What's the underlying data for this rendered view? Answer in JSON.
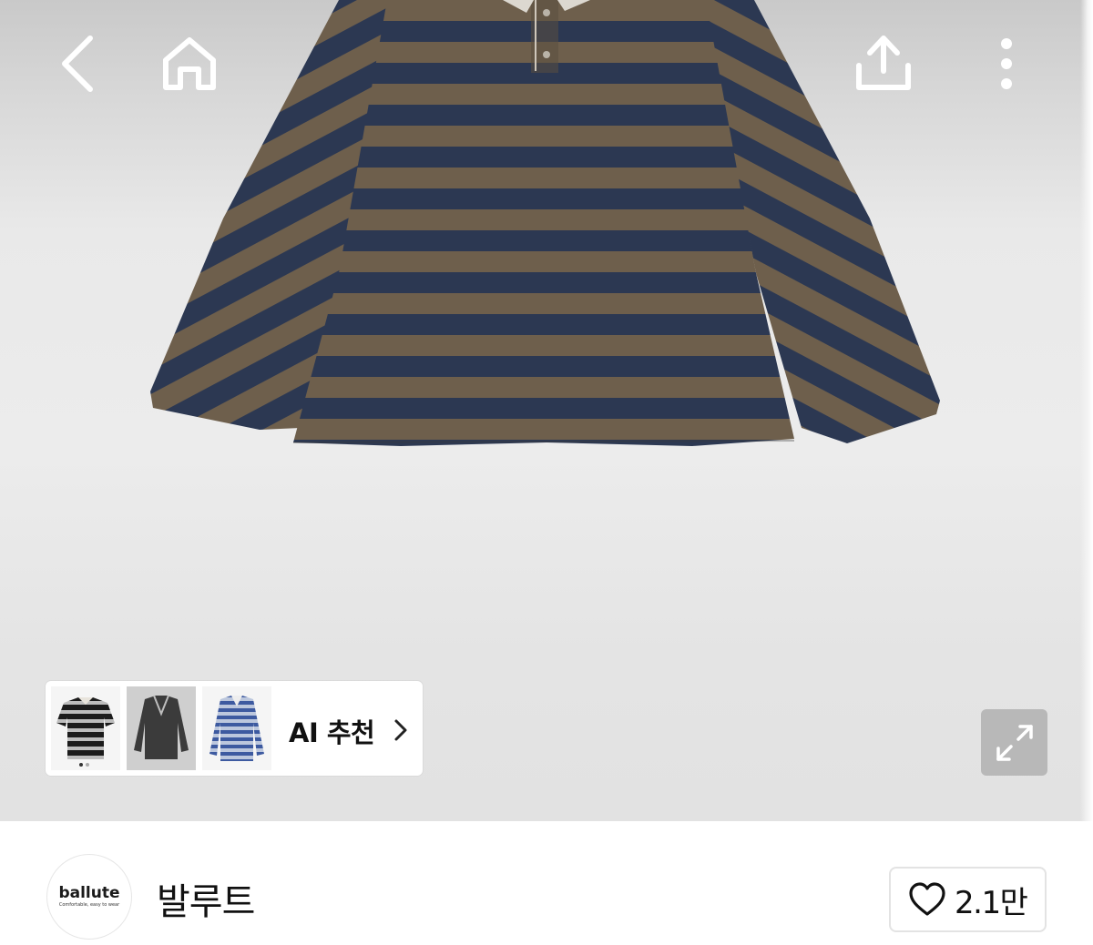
{
  "header": {
    "back_icon": "chevron-left-icon",
    "home_icon": "home-icon",
    "share_icon": "share-icon",
    "more_icon": "more-vertical-icon"
  },
  "product_image": {
    "subject": "striped-long-sleeve-polo"
  },
  "ai_recommend": {
    "label": "AI 추천",
    "chevron_icon": "chevron-right-icon",
    "thumbnails": [
      {
        "name": "thumb-black-striped-tee"
      },
      {
        "name": "thumb-dark-half-zip"
      },
      {
        "name": "thumb-blue-striped-polo"
      }
    ]
  },
  "expand": {
    "icon": "expand-icon"
  },
  "brand": {
    "logo_text": "ballute",
    "logo_tagline": "Comfortable, easy to wear",
    "name": "발루트",
    "like_icon": "heart-icon",
    "like_count": "2.1만"
  },
  "colors": {
    "stripe_brown": "#6e5f4c",
    "stripe_navy": "#2c3852",
    "panel_bg": "#ffffff",
    "expand_bg": "#b8b8b8"
  }
}
